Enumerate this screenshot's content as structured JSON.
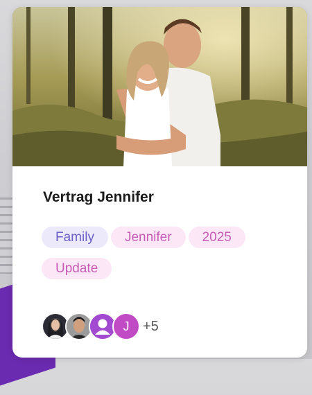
{
  "card": {
    "title": "Vertrag Jennifer",
    "tags": [
      {
        "label": "Family"
      },
      {
        "label": "Jennifer"
      },
      {
        "label": "2025"
      },
      {
        "label": "Update"
      }
    ],
    "avatars": [
      {
        "type": "photo",
        "icon": "user-photo"
      },
      {
        "type": "photo",
        "icon": "user-photo"
      },
      {
        "type": "icon",
        "icon": "person-icon",
        "color": "#a24bd1"
      },
      {
        "type": "initial",
        "initial": "J",
        "color": "#c04bc4"
      }
    ],
    "more_count": "+5"
  }
}
